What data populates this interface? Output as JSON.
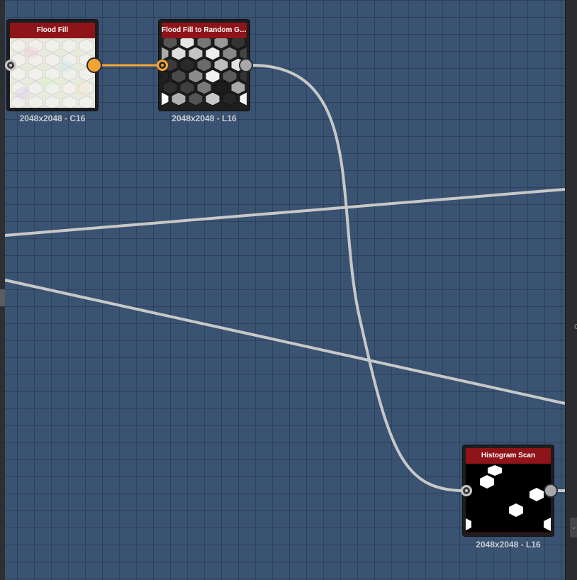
{
  "colors": {
    "canvas_background": "#3a5372",
    "node_header": "#8f1419",
    "active_wire": "#f4a531",
    "inactive_wire": "#c8c8c8"
  },
  "nodes": [
    {
      "title": "Flood Fill",
      "caption": "2048x2048 - C16",
      "thumbnail": "hexagon-color-pattern"
    },
    {
      "title": "Flood Fill to Random Gr...",
      "caption": "2048x2048 - L16",
      "thumbnail": "hexagon-grayscale-pattern"
    },
    {
      "title": "Histogram Scan",
      "caption": "2048x2048 - L16",
      "thumbnail": "sparse-white-hexagons"
    }
  ],
  "right_panel": {
    "collapse_glyph": "⌄",
    "edge_mark": "C"
  }
}
